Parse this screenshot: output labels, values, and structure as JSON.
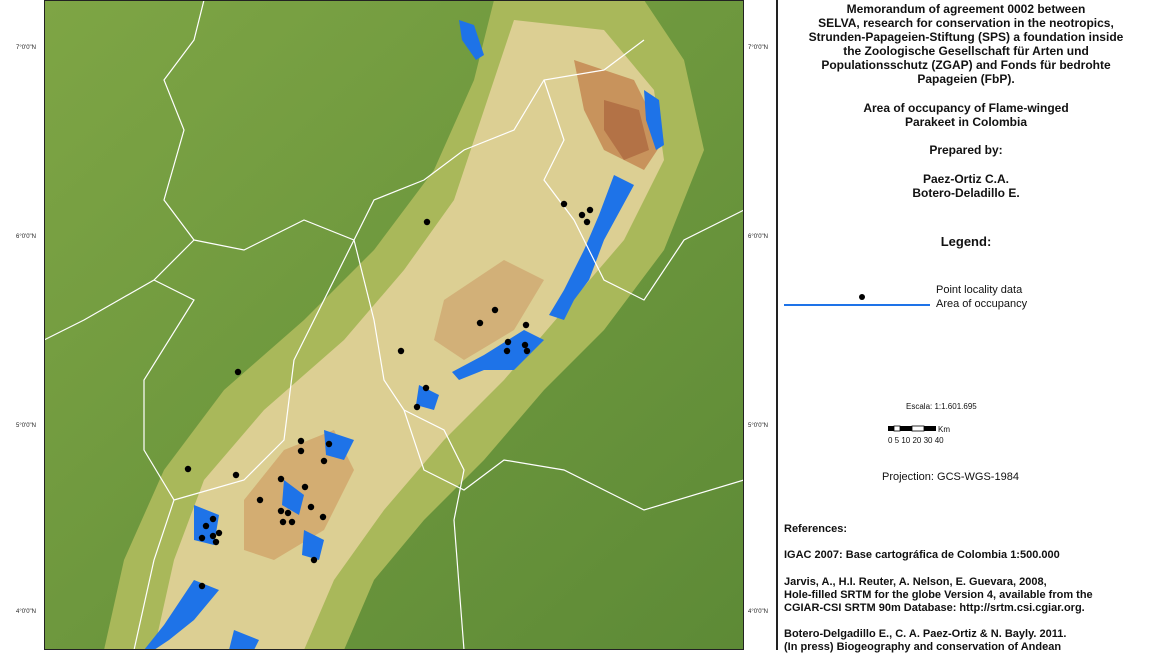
{
  "map": {
    "lat_labels": {
      "left": [
        "7°0'0\"N",
        "6°0'0\"N",
        "5°0'0\"N",
        "4°0'0\"N"
      ],
      "right": [
        "7°0'0\"N",
        "6°0'0\"N",
        "5°0'0\"N",
        "4°0'0\"N"
      ]
    },
    "colors": {
      "lowland": "#6f9e3f",
      "foothill": "#9fb450",
      "mid": "#d6c98a",
      "high": "#c9915a",
      "peak": "#b9784a",
      "occupancy": "#1e73e8",
      "boundary": "#ffffff",
      "point": "#000000"
    }
  },
  "legend": {
    "memo": "Memorandum of agreement 0002 between\nSELVA, research for conservation in the neotropics,\nStrunden-Papageien-Stiftung (SPS) a foundation inside\nthe Zoologische Gesellschaft für Arten und\nPopulationsschutz (ZGAP) and Fonds für bedrohte\nPapageien (FbP).",
    "subtitle": "Area of occupancy of Flame-winged\nParakeet in Colombia",
    "prepared_by_label": "Prepared by:",
    "authors": "Paez-Ortiz C.A.\nBotero-Deladillo E.",
    "legend_title": "Legend:",
    "point_label": "Point locality data",
    "area_label": "Area of occupancy",
    "scale": "Escala: 1:1.601.695",
    "scale_unit": "Km",
    "scale_ticks": "0 5 10  20  30  40",
    "projection": "Projection: GCS-WGS-1984",
    "references_title": "References:",
    "ref1": "IGAC 2007: Base cartográfica de Colombia 1:500.000",
    "ref2": "Jarvis, A., H.I. Reuter, A. Nelson, E. Guevara, 2008,\nHole-filled SRTM for the globe Version 4, available from the\nCGIAR-CSI SRTM 90m Database: http://srtm.csi.cgiar.org.",
    "ref3": "Botero-Delgadillo E., C. A. Paez-Ortiz & N. Bayly. 2011.\n(In press) Biogeography and conservation of Andean"
  }
}
